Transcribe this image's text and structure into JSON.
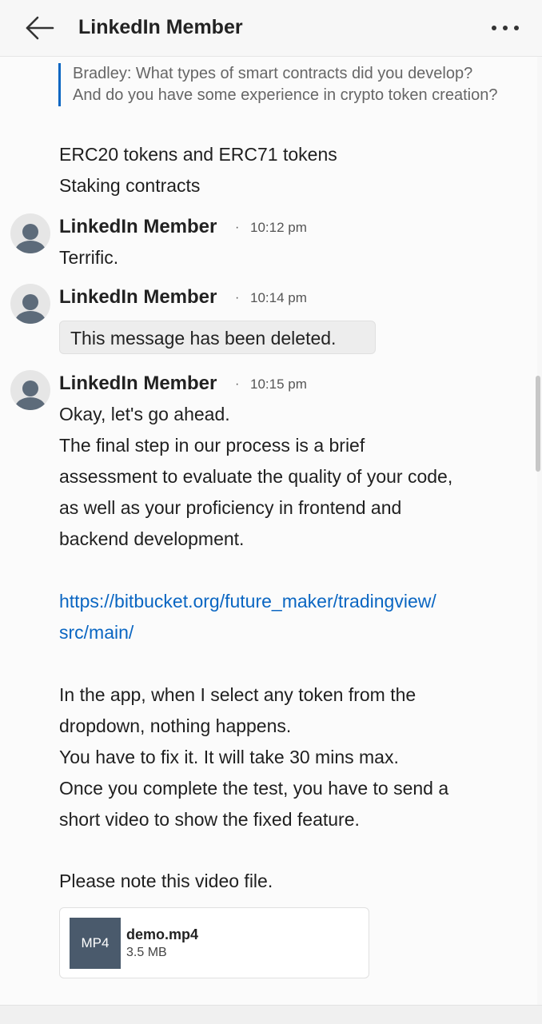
{
  "header": {
    "title": "LinkedIn Member",
    "back_icon": "arrow-left-icon",
    "more_icon": "more-horizontal-icon"
  },
  "quote": {
    "text": "Bradley: What types of smart contracts did you develop? And do you have some experience in crypto token creation?"
  },
  "messages_top": [
    "ERC20 tokens and ERC71 tokens",
    "Staking contracts"
  ],
  "message_groups": [
    {
      "sender": "LinkedIn Member",
      "time": "10:12 pm",
      "text": "Terrific."
    },
    {
      "sender": "LinkedIn Member",
      "time": "10:14 pm",
      "deleted_text": "This message has been deleted."
    },
    {
      "sender": "LinkedIn Member",
      "time": "10:15 pm",
      "lines": [
        "Okay, let's go ahead.",
        "The final step in our process is a brief",
        "assessment to evaluate the quality of your code,",
        "as well as your proficiency in frontend and",
        "backend development."
      ],
      "link_lines": [
        "https://bitbucket.org/future_maker/tradingview/",
        "src/main/"
      ],
      "lines2": [
        "In the app, when I select any token from the",
        "dropdown, nothing happens.",
        "You have to fix it. It will take 30 mins max.",
        "Once you complete the test, you have to send a",
        "short video to show the fixed feature."
      ],
      "note": "Please note this video file."
    }
  ],
  "attachment": {
    "badge": "MP4",
    "name": "demo.mp4",
    "size": "3.5 MB"
  },
  "separator": "·"
}
